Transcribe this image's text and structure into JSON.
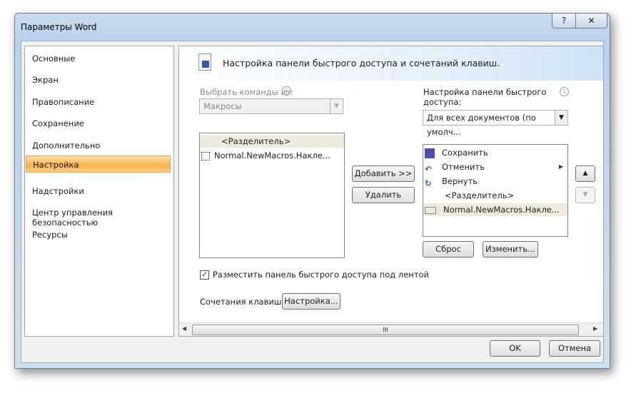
{
  "window": {
    "title": "Параметры Word",
    "help": "?",
    "close": "✕"
  },
  "sidebar": {
    "items": [
      {
        "label": "Основные"
      },
      {
        "label": "Экран"
      },
      {
        "label": "Правописание"
      },
      {
        "label": "Сохранение"
      },
      {
        "label": "Дополнительно"
      },
      {
        "label": "Настройка"
      },
      {
        "label": "Надстройки"
      },
      {
        "label": "Центр управления безопасностью"
      },
      {
        "label": "Ресурсы"
      }
    ],
    "selected": "Настройка"
  },
  "main": {
    "heading": "Настройка панели быстрого доступа и сочетаний клавиш.",
    "choose_label": "Выбрать команды из:",
    "choose_value": "Макросы",
    "left_list": [
      "<Разделитель>",
      "Normal.NewMacros.Накле..."
    ],
    "qat_label_1": "Настройка панели быстрого",
    "qat_label_2": "доступа:",
    "qat_value": "Для всех документов (по умолч...",
    "right_list": [
      "Сохранить",
      "Отменить",
      "Вернуть",
      "<Разделитель>",
      "Normal.NewMacros.Накле..."
    ],
    "add_button": "Добавить >>",
    "remove_button": "Удалить",
    "reset_button": "Сброс",
    "modify_button": "Изменить...",
    "below_ribbon_checkbox": "Разместить панель быстрого доступа под лентой",
    "below_ribbon_checked": true,
    "shortcuts_label": "Сочетания клавиш:",
    "shortcuts_button": "Настройка...",
    "scroll_grip": "III"
  },
  "footer": {
    "ok": "OK",
    "cancel": "Отмена"
  }
}
